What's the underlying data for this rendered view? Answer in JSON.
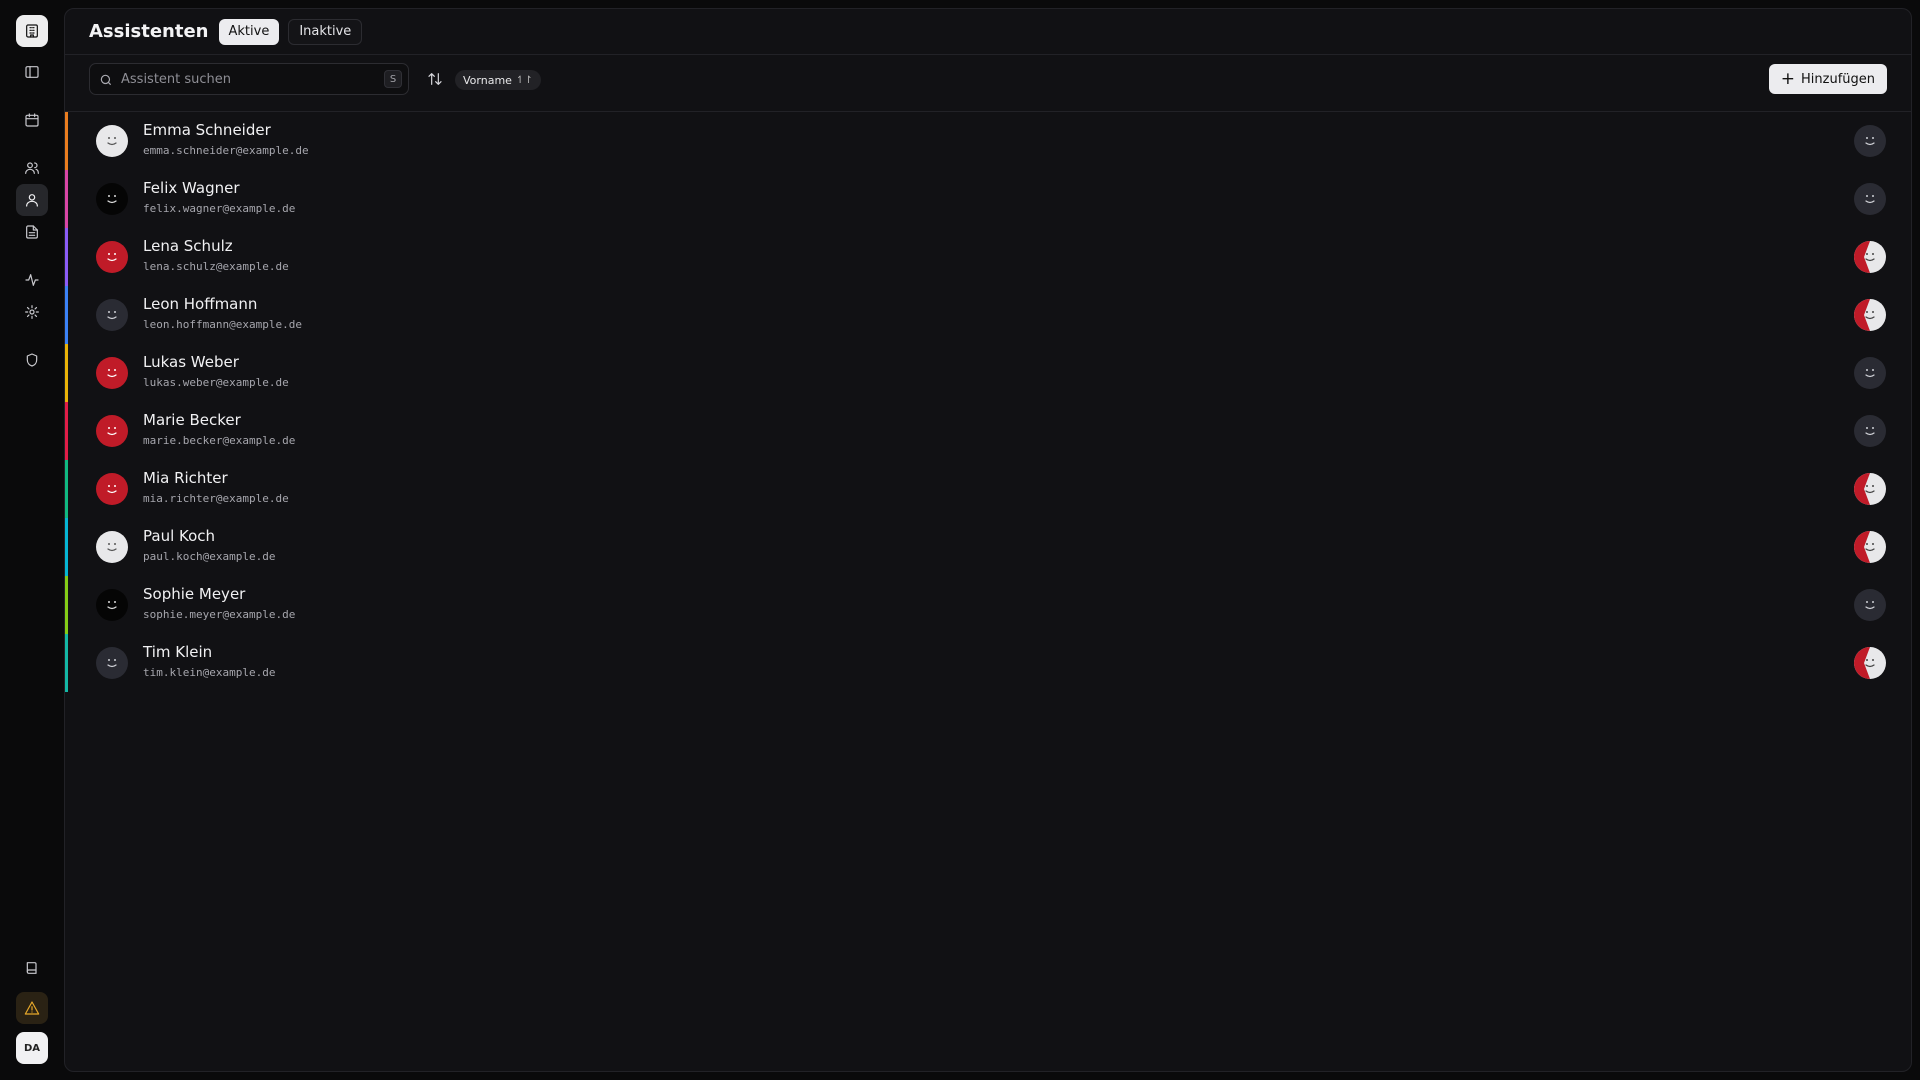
{
  "sidebar": {
    "items": [
      {
        "name": "building-icon"
      },
      {
        "name": "sidebar-toggle-icon"
      },
      {
        "name": "calendar-icon"
      },
      {
        "name": "users-icon"
      },
      {
        "name": "user-icon"
      },
      {
        "name": "document-icon"
      },
      {
        "name": "activity-icon"
      },
      {
        "name": "gear-icon"
      },
      {
        "name": "shield-icon"
      },
      {
        "name": "book-icon"
      },
      {
        "name": "warning-icon"
      }
    ],
    "user_initials": "DA"
  },
  "header": {
    "title": "Assistenten",
    "tabs": [
      {
        "label": "Aktive",
        "active": true
      },
      {
        "label": "Inaktive",
        "active": false
      }
    ]
  },
  "toolbar": {
    "search_placeholder": "Assistent suchen",
    "search_shortcut": "S",
    "sort_label": "Vorname",
    "sort_direction_icon": "↿↾",
    "add_label": "Hinzufügen"
  },
  "colors": {
    "accent_palette": [
      "#ea7d1f",
      "#d946a6",
      "#8b5cf6",
      "#3b82f6",
      "#eab308",
      "#e11d48",
      "#10b981",
      "#06b6d4",
      "#84cc16",
      "#14b8a6"
    ],
    "avatar_red": "#c01b28",
    "avatar_light": "#e8e8ea",
    "avatar_dark": "#2a2b33"
  },
  "assistants": [
    {
      "name": "Emma Schneider",
      "email": "emma.schneider@example.de",
      "accent": "#ea7d1f",
      "avatar_style": "light",
      "status_style": "dark"
    },
    {
      "name": "Felix Wagner",
      "email": "felix.wagner@example.de",
      "accent": "#d946a6",
      "avatar_style": "black",
      "status_style": "dark"
    },
    {
      "name": "Lena Schulz",
      "email": "lena.schulz@example.de",
      "accent": "#8b5cf6",
      "avatar_style": "red",
      "status_style": "red-light"
    },
    {
      "name": "Leon Hoffmann",
      "email": "leon.hoffmann@example.de",
      "accent": "#3b82f6",
      "avatar_style": "dark",
      "status_style": "red-light"
    },
    {
      "name": "Lukas Weber",
      "email": "lukas.weber@example.de",
      "accent": "#eab308",
      "avatar_style": "red",
      "status_style": "dark"
    },
    {
      "name": "Marie Becker",
      "email": "marie.becker@example.de",
      "accent": "#e11d48",
      "avatar_style": "red",
      "status_style": "dark"
    },
    {
      "name": "Mia Richter",
      "email": "mia.richter@example.de",
      "accent": "#10b981",
      "avatar_style": "red",
      "status_style": "red-light"
    },
    {
      "name": "Paul Koch",
      "email": "paul.koch@example.de",
      "accent": "#06b6d4",
      "avatar_style": "light",
      "status_style": "red-light"
    },
    {
      "name": "Sophie Meyer",
      "email": "sophie.meyer@example.de",
      "accent": "#84cc16",
      "avatar_style": "black",
      "status_style": "dark"
    },
    {
      "name": "Tim Klein",
      "email": "tim.klein@example.de",
      "accent": "#14b8a6",
      "avatar_style": "dark",
      "status_style": "red-light"
    }
  ]
}
